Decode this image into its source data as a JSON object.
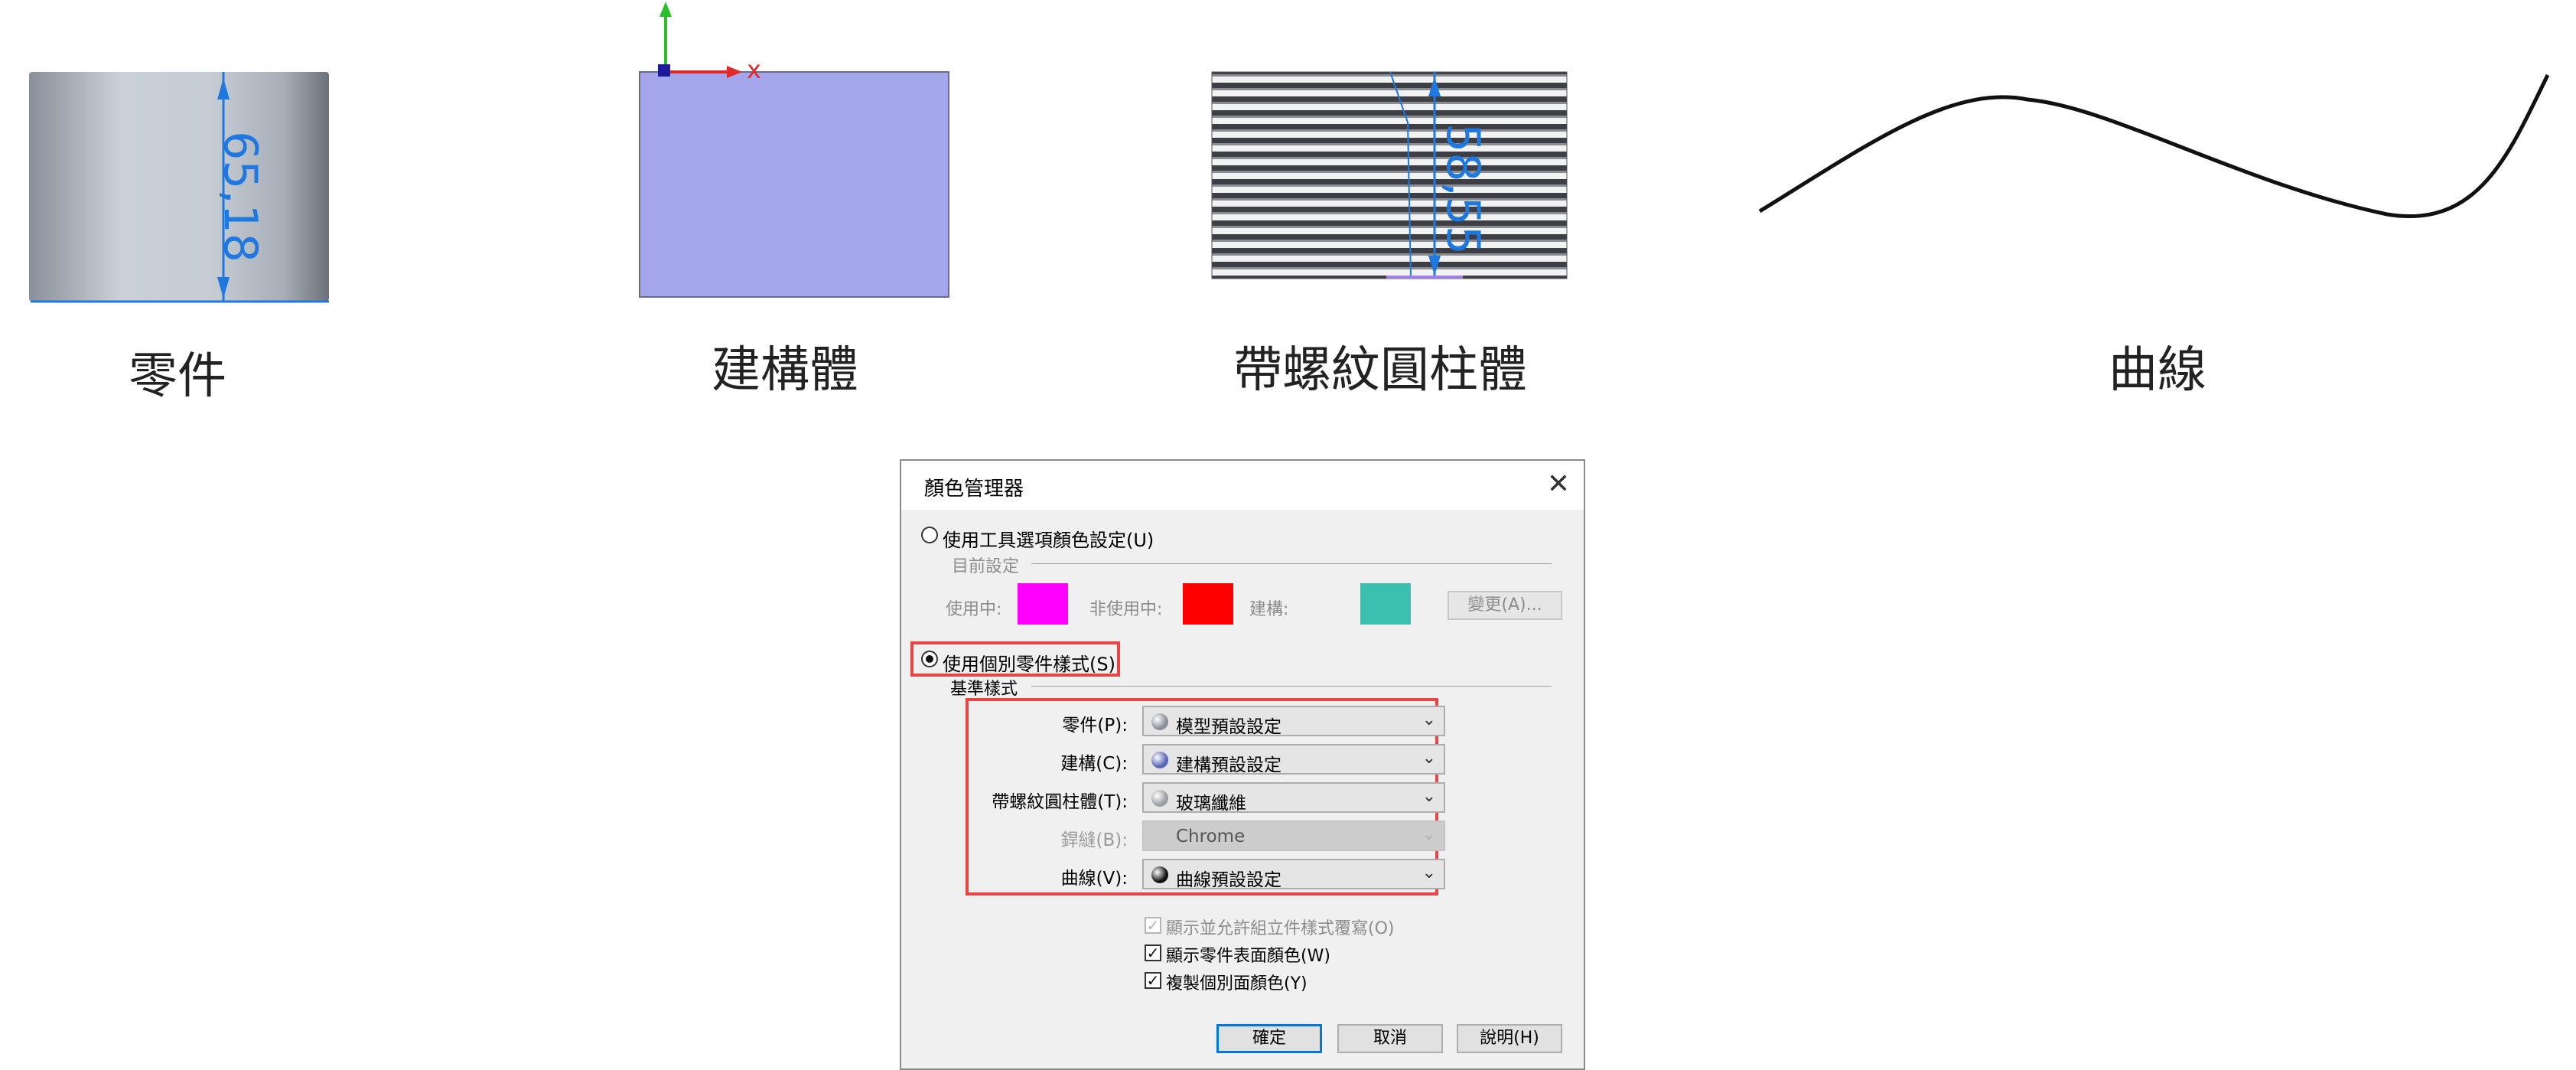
{
  "gallery": {
    "part": {
      "caption": "零件",
      "dimension": "65,18"
    },
    "construction": {
      "caption": "建構體",
      "axis_label": "x"
    },
    "threaded": {
      "caption": "帶螺紋圓柱體",
      "dimension": "58,55"
    },
    "curve": {
      "caption": "曲線"
    }
  },
  "dialog": {
    "title": "顏色管理器",
    "option_tools": "使用工具選項顏色設定(U)",
    "current_settings": "目前設定",
    "active_label": "使用中:",
    "inactive_label": "非使用中:",
    "construction_label": "建構:",
    "change_button": "變更(A)...",
    "option_individual": "使用個別零件樣式(S)",
    "base_style": "基準樣式",
    "fields": [
      {
        "label": "零件(P):",
        "value": "模型預設設定",
        "ball": "#8a8f96"
      },
      {
        "label": "建構(C):",
        "value": "建構預設設定",
        "ball": "#5a66b8"
      },
      {
        "label": "帶螺紋圓柱體(T):",
        "value": "玻璃纖維",
        "ball": "#9a9ea4"
      },
      {
        "label": "銲縫(B):",
        "value": "Chrome",
        "ball": ""
      },
      {
        "label": "曲線(V):",
        "value": "曲線預設設定",
        "ball": "#111111"
      }
    ],
    "checkboxes": [
      {
        "label": "顯示並允許組立件樣式覆寫(O)",
        "checked": true,
        "disabled": true
      },
      {
        "label": "顯示零件表面顏色(W)",
        "checked": true,
        "disabled": false
      },
      {
        "label": "複製個別面顏色(Y)",
        "checked": true,
        "disabled": false
      }
    ],
    "ok_button": "確定",
    "cancel_button": "取消",
    "help_button": "說明(H)"
  },
  "colors": {
    "active_swatch": "#ff00ff",
    "inactive_swatch": "#ff0000",
    "construction_swatch": "#3dbfb0",
    "dimension_blue": "#1e78e0",
    "highlight_red": "#e84545"
  }
}
